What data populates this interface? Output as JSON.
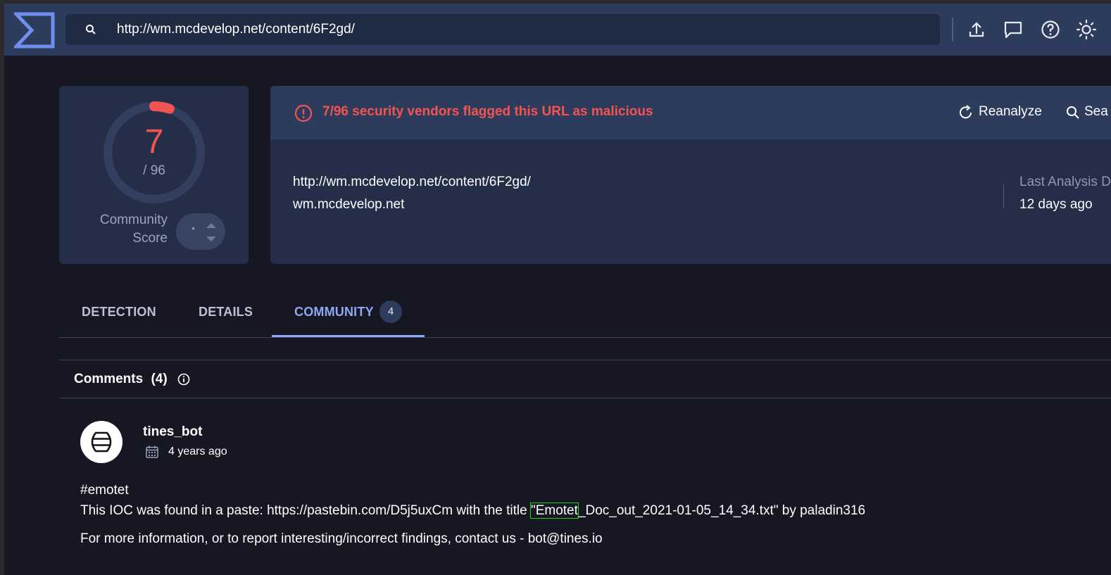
{
  "search": {
    "value": "http://wm.mcdevelop.net/content/6F2gd/"
  },
  "toolbar_icons": [
    "upload-icon",
    "chat-icon",
    "help-icon",
    "theme-icon"
  ],
  "score": {
    "detections": "7",
    "total": "/ 96",
    "fraction_flagged": 0.0729,
    "community_label_line1": "Community",
    "community_label_line2": "Score",
    "vote_dot": "•"
  },
  "alert": {
    "text": "7/96 security vendors flagged this URL as malicious"
  },
  "actions": {
    "reanalyze": "Reanalyze",
    "search": "Sea"
  },
  "target": {
    "url": "http://wm.mcdevelop.net/content/6F2gd/",
    "domain": "wm.mcdevelop.net"
  },
  "last_analysis": {
    "label": "Last Analysis D",
    "value": "12 days ago"
  },
  "tabs": [
    {
      "label": "DETECTION"
    },
    {
      "label": "DETAILS"
    },
    {
      "label": "COMMUNITY",
      "badge": "4"
    }
  ],
  "comments": {
    "title": "Comments",
    "count": "(4)",
    "items": [
      {
        "author": "tines_bot",
        "time": "4 years ago",
        "tag": "#emotet",
        "line1_pre": "This IOC was found in a paste: https://pastebin.com/D5j5uxCm with the title ",
        "line1_highlight": "\"Emotet",
        "line1_post": "_Doc_out_2021-01-05_14_34.txt\" by paladin316",
        "line2": "For more information, or to report interesting/incorrect findings, contact us - bot@tines.io"
      }
    ]
  },
  "colors": {
    "accent": "#8fa8f5",
    "malicious": "#f25452",
    "highlight": "#1ed31e"
  }
}
